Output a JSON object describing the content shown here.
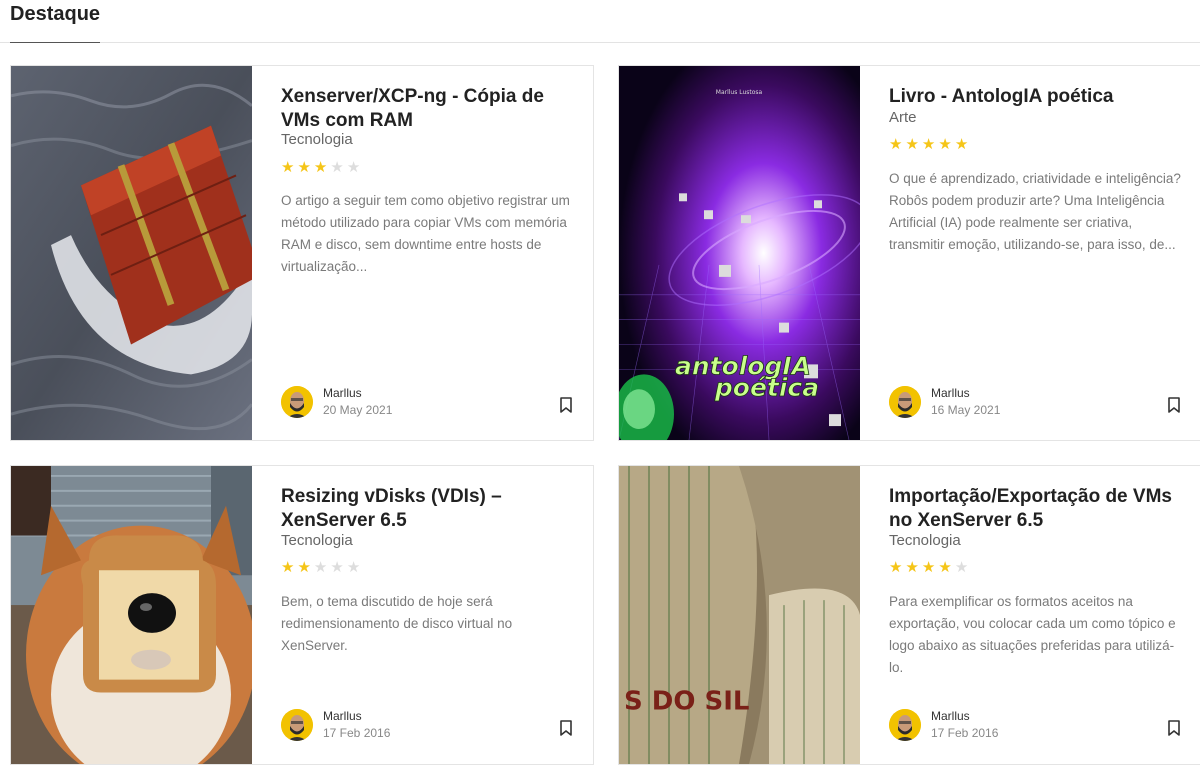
{
  "section": {
    "title": "Destaque"
  },
  "cards": [
    {
      "title": "Xenserver/XCP-ng - Cópia de VMs com RAM",
      "category": "Tecnologia",
      "rating": 3,
      "excerpt": "O artigo a seguir tem como objetivo registrar um método utilizado para copiar VMs com memória RAM e disco, sem downtime entre hosts de virtualização...",
      "author": "Marllus",
      "date": "20 May 2021",
      "image": "treasure-chest-in-sea"
    },
    {
      "title": "Livro - AntologIA poética",
      "category": "Arte",
      "rating": 5,
      "excerpt": "O que é aprendizado, criatividade e inteligência? Robôs podem produzir arte? Uma Inteligência Artificial (IA) pode realmente ser criativa, transmitir emoção, utilizando-se, para isso, de...",
      "author": "Marllus",
      "date": "16 May 2021",
      "image": "book-cover",
      "cover_author": "Marllus Lustosa",
      "cover_title_line1": "antologIA",
      "cover_title_line2": "poética"
    },
    {
      "title": "Resizing vDisks (VDIs) – XenServer 6.5",
      "category": "Tecnologia",
      "rating": 2,
      "excerpt": "Bem, o tema discutido de hoje será redimensionamento de disco virtual no XenServer.",
      "author": "Marllus",
      "date": "17 Feb 2016",
      "image": "dog-with-bread"
    },
    {
      "title": "Importação/Exportação de VMs no XenServer 6.5",
      "category": "Tecnologia",
      "rating": 4,
      "excerpt": "Para exemplificar os formatos aceitos na exportação, vou colocar cada um como tópico e logo abaixo as situações preferidas para utilizá-lo.",
      "author": "Marllus",
      "date": "17 Feb 2016",
      "image": "coffee-sacks",
      "sack_text": "S DO SIL"
    }
  ],
  "colors": {
    "star_on": "#f5c518",
    "star_off": "#dddddd",
    "avatar_bg": "#f2c200"
  },
  "icons": {
    "bookmark": "bookmark-icon",
    "star": "star-icon"
  }
}
